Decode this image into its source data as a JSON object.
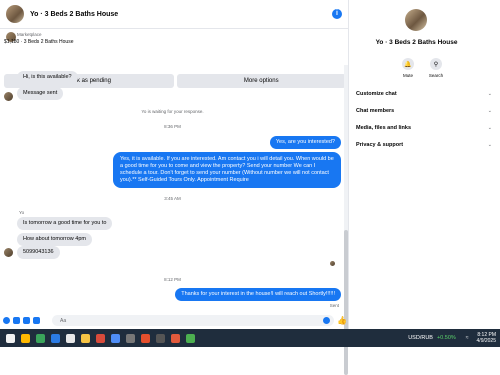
{
  "header": {
    "title": "Yo · 3 Beds 2 Baths House"
  },
  "listing": {
    "subtitle": "Marketplace",
    "price_line": "$1,180 · 3 Beds 2 Baths House"
  },
  "buttons": {
    "mark_pending": "Mark as pending",
    "more_options": "More options"
  },
  "messages": {
    "m1": "Hi, is this available?",
    "m2": "Message sent",
    "waiting": "Yo is waiting for your response.",
    "t1": "8:36 PM",
    "m3": "Yes, are you interested?",
    "m4": "Yes, it is available. If you are interested.  Am contact you i will detail you.  When would be a good time for you to come and view the property? Send your number We can I schedule a tour.  Don't forget to send your number (Without number we will not contact you).** Self-Guided Tours Only. Appointment Require",
    "t2": "3:45 AM",
    "sender": "Yo",
    "m5": "Is tomorrow a good time for you to",
    "m6": "How about tomorrow 4pm",
    "m7": "5099043136",
    "t3": "8:12 PM",
    "m8": "Thanks for your interest in the house!I will reach out Shortly!!!!!!",
    "sent": "Sent"
  },
  "composer": {
    "aa": "Aa"
  },
  "side": {
    "title": "Yo · 3 Beds 2 Baths House",
    "mute": "Mute",
    "search": "Search",
    "items": [
      "Customize chat",
      "Chat members",
      "Media, files and links",
      "Privacy & support"
    ]
  },
  "taskbar": {
    "ticker": "USD/RUB",
    "change": "+0.50%",
    "time": "8:12 PM",
    "date": "4/9/2025"
  },
  "colors": {
    "accent": "#1877f2",
    "bubble_in": "#e4e6eb",
    "taskbar": "#1f2d3d"
  }
}
